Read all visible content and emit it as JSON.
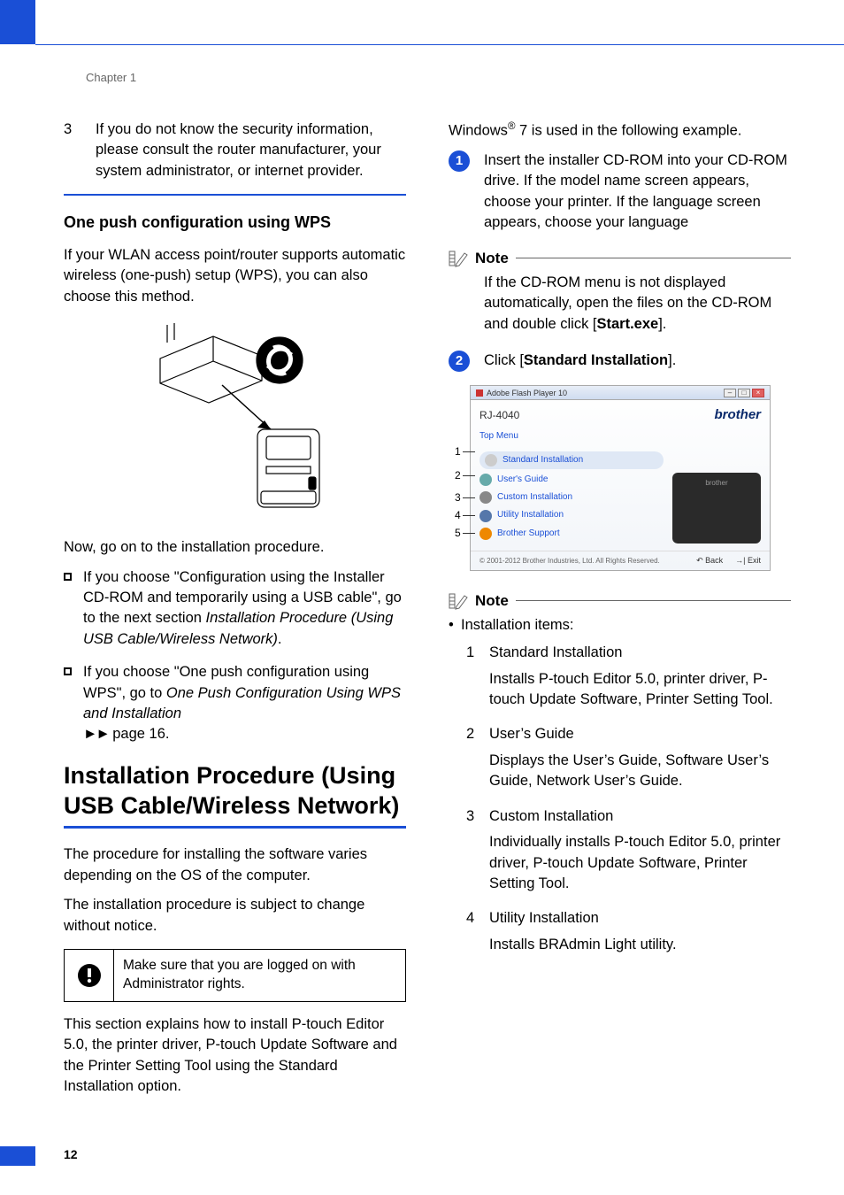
{
  "chapter": "Chapter 1",
  "left": {
    "para3_num": "3",
    "para3": "If you do not know the security information, please consult the router manufacturer, your system administrator, or internet provider.",
    "wps_h": "One push configuration using WPS",
    "wps_p": "If your WLAN access point/router supports automatic wireless (one-push) setup (WPS), you can also choose this method.",
    "after_fig": "Now, go on to the installation procedure.",
    "b1a": "If you choose \"Configuration using the Installer CD-ROM and temporarily using a USB cable\", go to the next section ",
    "b1b": "Installation Procedure (Using USB Cable/Wireless Network)",
    "b1c": ".",
    "b2a": "If you choose \"One push configuration using WPS\", go to ",
    "b2b": "One Push Configuration Using WPS and Installation",
    "b2c": " page 16.",
    "h2a": "Installation Procedure (Using",
    "h2b": "USB Cable/Wireless Network)",
    "p1": "The procedure for installing the software varies depending on the OS of the computer.",
    "p2": "The installation procedure is subject to change without notice.",
    "warn": "Make sure that you are logged on with Administrator rights.",
    "p3": "This section explains how to install P-touch Editor 5.0, the printer driver, P-touch Update Software and the Printer Setting Tool using the Standard Installation option."
  },
  "right": {
    "win7": "Windows® 7 is used in the following example.",
    "s1": "Insert the installer CD-ROM into your CD-ROM drive. If the model name screen appears, choose your printer. If the language screen appears, choose your language",
    "note": "Note",
    "note1a": "If the CD-ROM menu is not displayed automatically, open the files on the CD-ROM and double click [",
    "note1b": "Start.exe",
    "note1c": "].",
    "s2a": "Click [",
    "s2b": "Standard Installation",
    "s2c": "].",
    "inst_title": "Adobe Flash Player 10",
    "inst_model": "RJ-4040",
    "inst_brand": "brother",
    "inst_top": "Top Menu",
    "inst_items": [
      "Standard Installation",
      "User's Guide",
      "Custom Installation",
      "Utility Installation",
      "Brother Support"
    ],
    "inst_copy": "© 2001-2012 Brother Industries, Ltd. All Rights Reserved.",
    "inst_back": "Back",
    "inst_exit": "Exit",
    "co": [
      "1",
      "2",
      "3",
      "4",
      "5"
    ],
    "note2_head": "Installation items:",
    "items": [
      {
        "n": "1",
        "t": "Standard Installation",
        "d": "Installs P-touch Editor 5.0, printer driver, P-touch Update Software, Printer Setting Tool."
      },
      {
        "n": "2",
        "t": "User’s Guide",
        "d": "Displays the User’s Guide, Software User’s Guide, Network User’s Guide."
      },
      {
        "n": "3",
        "t": "Custom Installation",
        "d": "Individually installs P-touch Editor 5.0, printer driver, P-touch Update Software, Printer Setting Tool."
      },
      {
        "n": "4",
        "t": "Utility Installation",
        "d": "Installs BRAdmin Light utility."
      }
    ]
  },
  "page_num": "12"
}
